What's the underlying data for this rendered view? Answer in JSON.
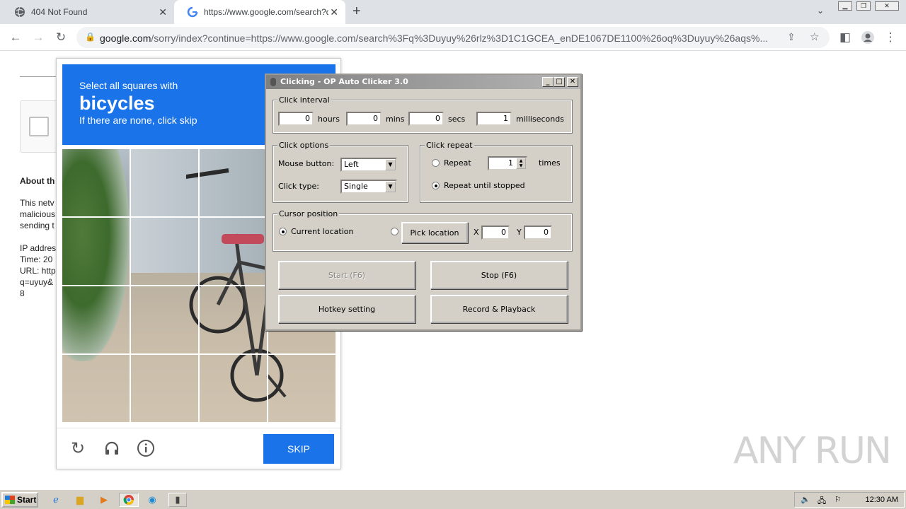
{
  "browser": {
    "tabs": [
      {
        "title": "404 Not Found",
        "icon": "globe-icon"
      },
      {
        "title": "https://www.google.com/search?q=",
        "icon": "google-icon"
      }
    ],
    "url_host": "google.com",
    "url_rest": "/sorry/index?continue=https://www.google.com/search%3Fq%3Duyuy%26rlz%3D1C1GCEA_enDE1067DE1100%26oq%3Duyuy%26aqs%..."
  },
  "background_page": {
    "heading": "About th",
    "para1": [
      "This netv",
      "malicious",
      "sending t"
    ],
    "para2": [
      "IP addres",
      "Time: 20",
      "URL: http",
      "q=uyuy&",
      "8"
    ]
  },
  "captcha": {
    "line1": "Select all squares with",
    "keyword": "bicycles",
    "line3": "If there are none, click skip",
    "skip_label": "SKIP",
    "accent": "#1a73e8"
  },
  "clicker": {
    "title": "Clicking - OP Auto Clicker 3.0",
    "interval": {
      "label": "Click interval",
      "hours": "0",
      "hours_label": "hours",
      "mins": "0",
      "mins_label": "mins",
      "secs": "0",
      "secs_label": "secs",
      "ms": "1",
      "ms_label": "milliseconds"
    },
    "options": {
      "label": "Click options",
      "mouse_label": "Mouse button:",
      "mouse_value": "Left",
      "type_label": "Click type:",
      "type_value": "Single"
    },
    "repeat": {
      "label": "Click repeat",
      "repeat_label": "Repeat",
      "repeat_value": "1",
      "times_label": "times",
      "until_label": "Repeat until stopped"
    },
    "cursor": {
      "label": "Cursor position",
      "current_label": "Current location",
      "pick_label": "Pick location",
      "x_label": "X",
      "x_value": "0",
      "y_label": "Y",
      "y_value": "0"
    },
    "buttons": {
      "start": "Start (F6)",
      "stop": "Stop (F6)",
      "hotkey": "Hotkey setting",
      "record": "Record & Playback"
    }
  },
  "watermark": "ANY RUN",
  "taskbar": {
    "start_label": "Start",
    "clock": "12:30 AM"
  }
}
